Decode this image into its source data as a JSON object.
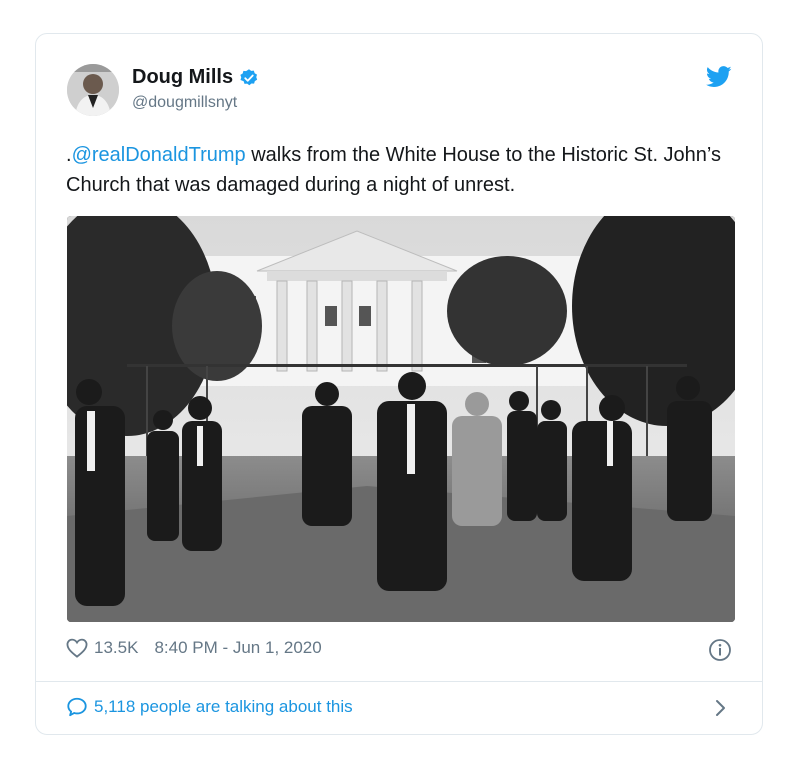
{
  "tweet": {
    "author": {
      "display_name": "Doug Mills",
      "handle": "@dougmillsnyt",
      "verified": true
    },
    "text_prefix": ".",
    "mention": "@realDonaldTrump",
    "text_rest": " walks from the White House to the Historic St. John’s Church that was damaged during a night of unrest.",
    "likes": "13.5K",
    "timestamp": "8:40 PM - Jun 1, 2020",
    "conversation": "5,118 people are talking about this"
  },
  "colors": {
    "link": "#1b95e0",
    "muted": "#657786",
    "border": "#e1e8ed"
  },
  "icons": [
    "verified-badge-icon",
    "twitter-bird-icon",
    "heart-icon",
    "info-icon",
    "speech-bubble-icon",
    "chevron-right-icon"
  ]
}
